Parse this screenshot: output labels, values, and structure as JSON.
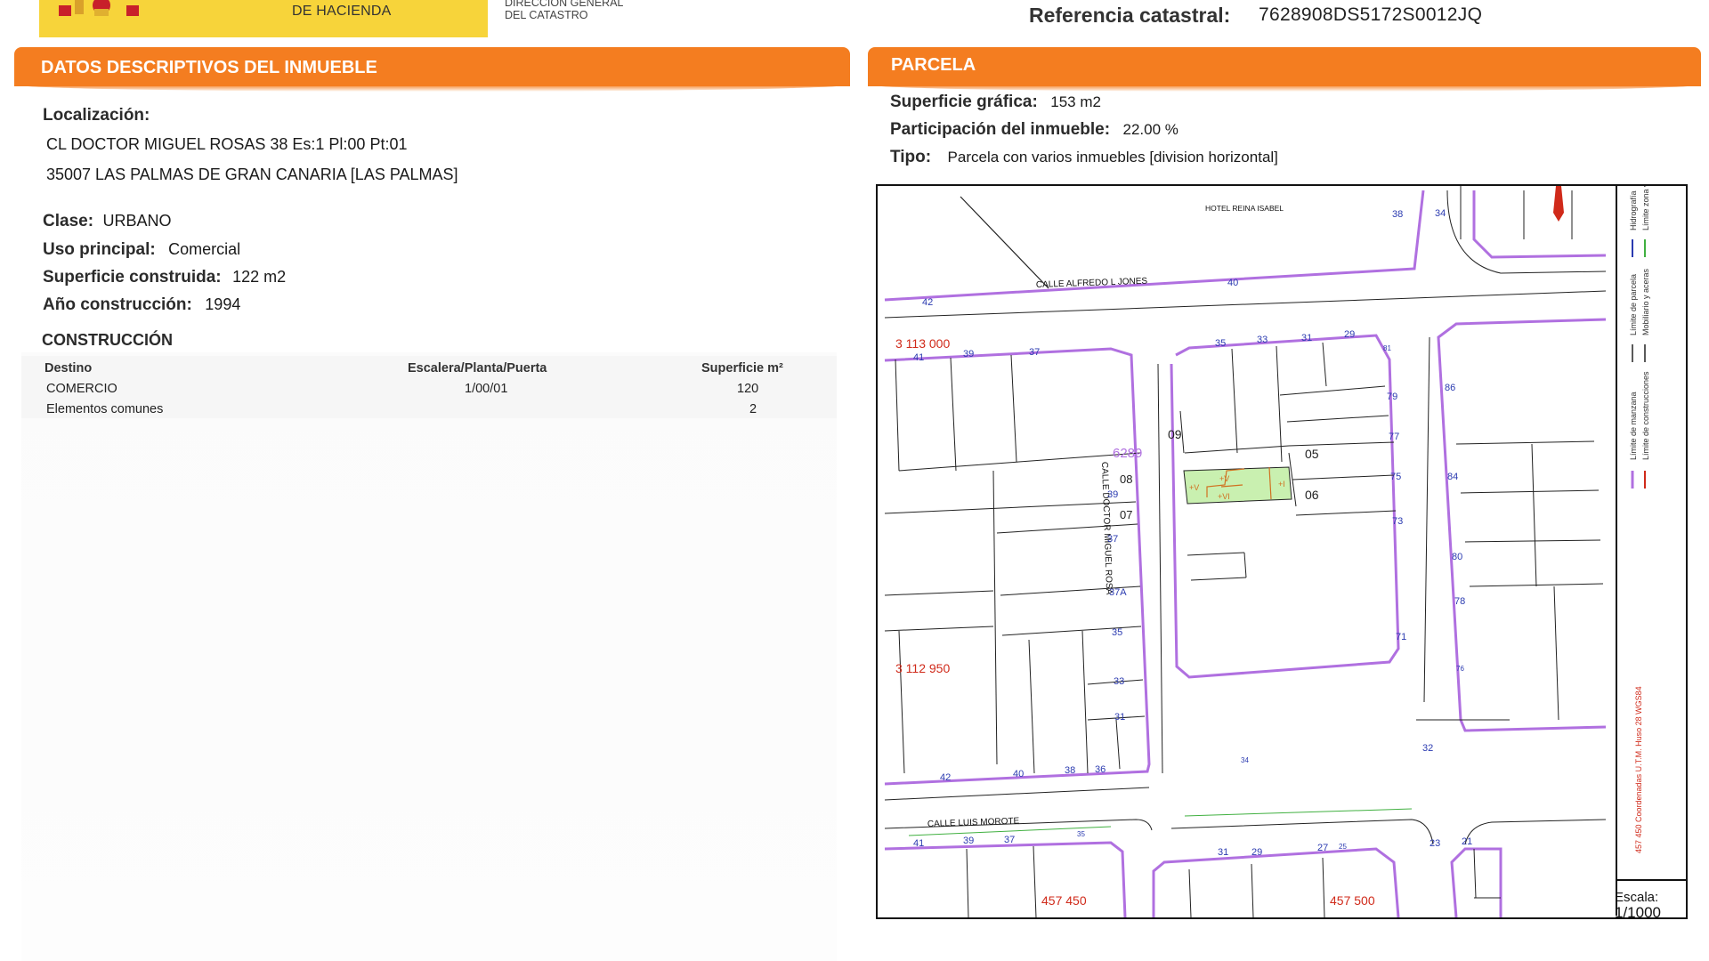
{
  "header": {
    "ministry_line": "DE HACIENDA",
    "direction_line1": "DIRECCIÓN GENERAL",
    "direction_line2": "DEL CATASTRO",
    "ref_label": "Referencia catastral:",
    "ref_value": "7628908DS5172S0012JQ"
  },
  "left_section": {
    "title": "DATOS DESCRIPTIVOS DEL INMUEBLE",
    "localizacion_label": "Localización:",
    "address_line1": "CL DOCTOR MIGUEL ROSAS 38 Es:1 Pl:00 Pt:01",
    "address_line2": "35007 LAS PALMAS DE GRAN CANARIA [LAS PALMAS]",
    "clase_label": "Clase:",
    "clase_value": "URBANO",
    "uso_label": "Uso principal:",
    "uso_value": "Comercial",
    "superficie_label": "Superficie construida:",
    "superficie_value": "122 m2",
    "anio_label": "Año construcción:",
    "anio_value": "1994",
    "construccion_title": "CONSTRUCCIÓN",
    "table": {
      "headers": [
        "Destino",
        "Escalera/Planta/Puerta",
        "Superficie m²"
      ],
      "rows": [
        [
          "COMERCIO",
          "1/00/01",
          "120"
        ],
        [
          "Elementos comunes",
          "",
          "2"
        ]
      ]
    }
  },
  "right_section": {
    "title": "PARCELA",
    "superficie_label": "Superficie gráfica:",
    "superficie_value": "153 m2",
    "participacion_label": "Participación del inmueble:",
    "participacion_value": "22.00 %",
    "tipo_label": "Tipo:",
    "tipo_value": "Parcela con varios inmuebles [division horizontal]"
  },
  "map": {
    "streets": [
      "CALLE ALFREDO L JONES",
      "CALLE DOCTOR MIGUEL ROSA",
      "CALLE LUIS MOROTE",
      "HOTEL REINA ISABEL"
    ],
    "block_id": "6289",
    "parcel_numbers": [
      "09",
      "05",
      "06",
      "08",
      "07"
    ],
    "coords_y": [
      "3 113 000",
      "3 112 950"
    ],
    "coords_x": [
      "457 450",
      "457 500"
    ],
    "house_numbers": [
      "42",
      "40",
      "41",
      "39",
      "37",
      "35",
      "33",
      "31",
      "29",
      "81",
      "79",
      "77",
      "75",
      "73",
      "71",
      "86",
      "84",
      "80",
      "78",
      "76",
      "39",
      "37",
      "37A",
      "35",
      "33",
      "31",
      "42",
      "40",
      "38",
      "36",
      "34",
      "32",
      "41",
      "39",
      "37",
      "35",
      "31",
      "29",
      "27",
      "25",
      "23",
      "21",
      "38",
      "34"
    ],
    "legend": [
      "Límite de manzana",
      "Límite de construcciones",
      "Límite de parcela",
      "Mobiliario y aceras",
      "Hidrografía",
      "Límite zona verde"
    ],
    "projection_note": "457 450 Coordenadas U.T.M. Huso 28 WGS84",
    "scale_label": "Escala:",
    "scale_value": "1/1000"
  },
  "colors": {
    "orange_bar": "#f47d20",
    "logo_yellow": "#f7d43a",
    "block_line": "#b070e0",
    "parcel_highlight": "#c9f0b0",
    "coord_red": "#d02a1a",
    "house_number_blue": "#2a3ab0"
  }
}
